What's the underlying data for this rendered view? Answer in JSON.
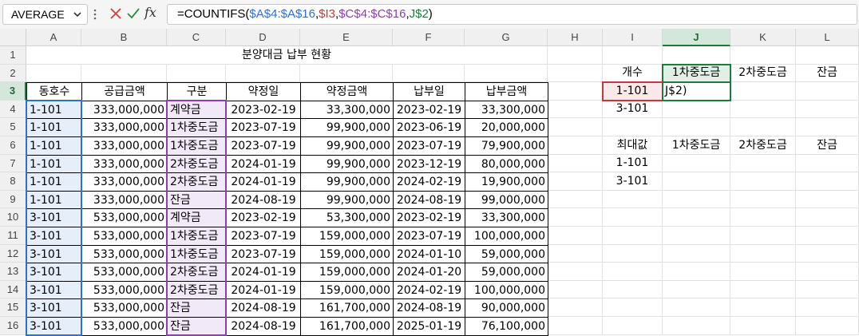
{
  "formula_bar": {
    "name_box": "AVERAGE",
    "fx_label": "fx",
    "formula_parts": [
      "=COUNTIFS(",
      "$A$4:$A$16",
      ",",
      "$I3",
      ",",
      "$C$4:$C$16",
      ",",
      "J$2",
      ")"
    ]
  },
  "columns": [
    "A",
    "B",
    "C",
    "D",
    "E",
    "F",
    "G",
    "H",
    "I",
    "J",
    "K",
    "L"
  ],
  "rows": [
    "1",
    "2",
    "3",
    "4",
    "5",
    "6",
    "7",
    "8",
    "9",
    "10",
    "11",
    "12",
    "13",
    "14",
    "15",
    "16"
  ],
  "title": "분양대금 납부 현황",
  "table": {
    "headers": [
      "동호수",
      "공급금액",
      "구분",
      "약정일",
      "약정금액",
      "납부일",
      "납부금액"
    ],
    "rows": [
      [
        "1-101",
        "333,000,000",
        "계약금",
        "2023-02-19",
        "33,300,000",
        "2023-02-19",
        "33,300,000"
      ],
      [
        "1-101",
        "333,000,000",
        "1차중도금",
        "2023-07-19",
        "99,900,000",
        "2023-06-19",
        "20,000,000"
      ],
      [
        "1-101",
        "333,000,000",
        "1차중도금",
        "2023-07-19",
        "99,900,000",
        "2023-07-19",
        "79,900,000"
      ],
      [
        "1-101",
        "333,000,000",
        "2차중도금",
        "2024-01-19",
        "99,900,000",
        "2023-12-19",
        "80,000,000"
      ],
      [
        "1-101",
        "333,000,000",
        "2차중도금",
        "2024-01-19",
        "99,900,000",
        "2024-02-19",
        "19,900,000"
      ],
      [
        "1-101",
        "333,000,000",
        "잔금",
        "2024-08-19",
        "99,900,000",
        "2024-08-19",
        "99,000,000"
      ],
      [
        "3-101",
        "533,000,000",
        "계약금",
        "2023-02-19",
        "53,300,000",
        "2023-02-19",
        "33,300,000"
      ],
      [
        "3-101",
        "533,000,000",
        "1차중도금",
        "2023-07-19",
        "159,000,000",
        "2023-07-19",
        "100,000,000"
      ],
      [
        "3-101",
        "533,000,000",
        "1차중도금",
        "2023-07-19",
        "159,000,000",
        "2024-01-10",
        "59,000,000"
      ],
      [
        "3-101",
        "533,000,000",
        "2차중도금",
        "2024-01-19",
        "159,000,000",
        "2024-01-20",
        "59,000,000"
      ],
      [
        "3-101",
        "533,000,000",
        "2차중도금",
        "2024-01-19",
        "159,000,000",
        "2024-02-19",
        "100,000,000"
      ],
      [
        "3-101",
        "533,000,000",
        "잔금",
        "2024-08-19",
        "161,700,000",
        "2024-08-19",
        "90,000,000"
      ],
      [
        "3-101",
        "533,000,000",
        "잔금",
        "2024-08-19",
        "161,700,000",
        "2025-01-19",
        "76,100,000"
      ]
    ]
  },
  "summary": {
    "count_label": "개수",
    "count_headers": [
      "1차중도금",
      "2차중도금",
      "잔금"
    ],
    "count_rows": [
      "1-101",
      "3-101"
    ],
    "editing_cell_text": "J$2)",
    "max_label": "최대값",
    "max_headers": [
      "1차중도금",
      "2차중도금",
      "잔금"
    ],
    "max_rows": [
      "1-101",
      "3-101"
    ]
  },
  "colors": {
    "selection_green": "#1e7a3e",
    "ref_blue": "#2e6fd6",
    "ref_red": "#c23a3a",
    "ref_purple": "#8b3fb0",
    "ref_green": "#1f7a3e"
  }
}
